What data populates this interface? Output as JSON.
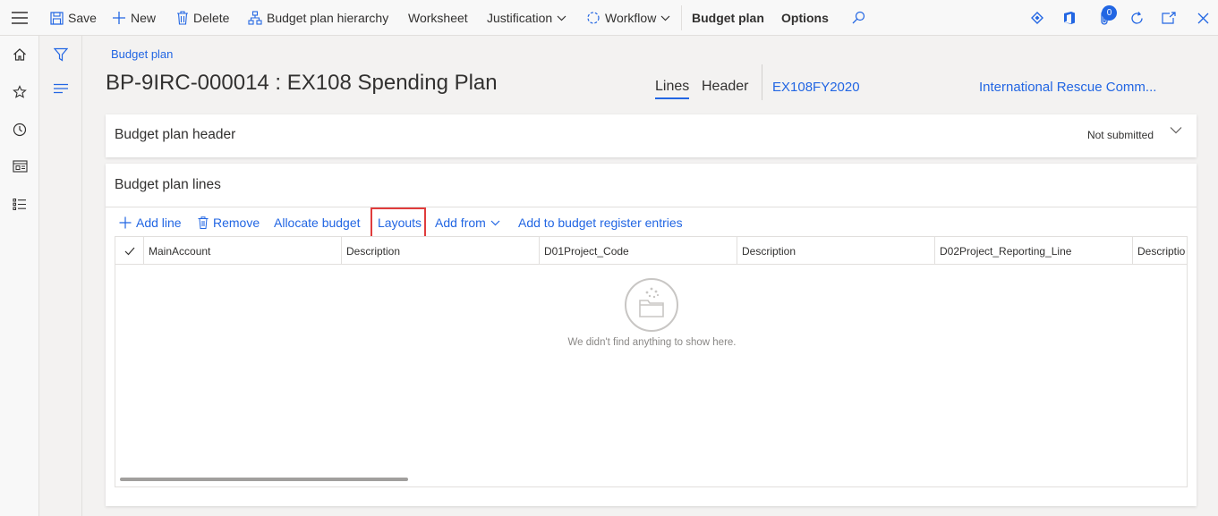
{
  "toolbar": {
    "save": "Save",
    "new": "New",
    "delete": "Delete",
    "hierarchy": "Budget plan hierarchy",
    "worksheet": "Worksheet",
    "justification": "Justification",
    "workflow": "Workflow",
    "budget_plan": "Budget plan",
    "options": "Options",
    "notification_count": "0"
  },
  "page": {
    "breadcrumb": "Budget plan",
    "title": "BP-9IRC-000014 : EX108 Spending Plan",
    "tabs": [
      {
        "label": "Lines",
        "active": true
      },
      {
        "label": "Header",
        "active": false
      }
    ],
    "scenario_link": "EX108FY2020",
    "entity_link": "International Rescue Comm..."
  },
  "header_section": {
    "title": "Budget plan header",
    "status": "Not submitted"
  },
  "lines_section": {
    "title": "Budget plan lines",
    "actions": {
      "add_line": "Add line",
      "remove": "Remove",
      "allocate": "Allocate budget",
      "layouts": "Layouts",
      "add_from": "Add from",
      "add_register": "Add to budget register entries"
    },
    "columns": [
      "MainAccount",
      "Description",
      "D01Project_Code",
      "Description",
      "D02Project_Reporting_Line",
      "Descriptio"
    ],
    "empty_message": "We didn't find anything to show here."
  },
  "colors": {
    "accent": "#2266e3",
    "highlight": "#e03c3c",
    "background": "#f3f2f1"
  }
}
